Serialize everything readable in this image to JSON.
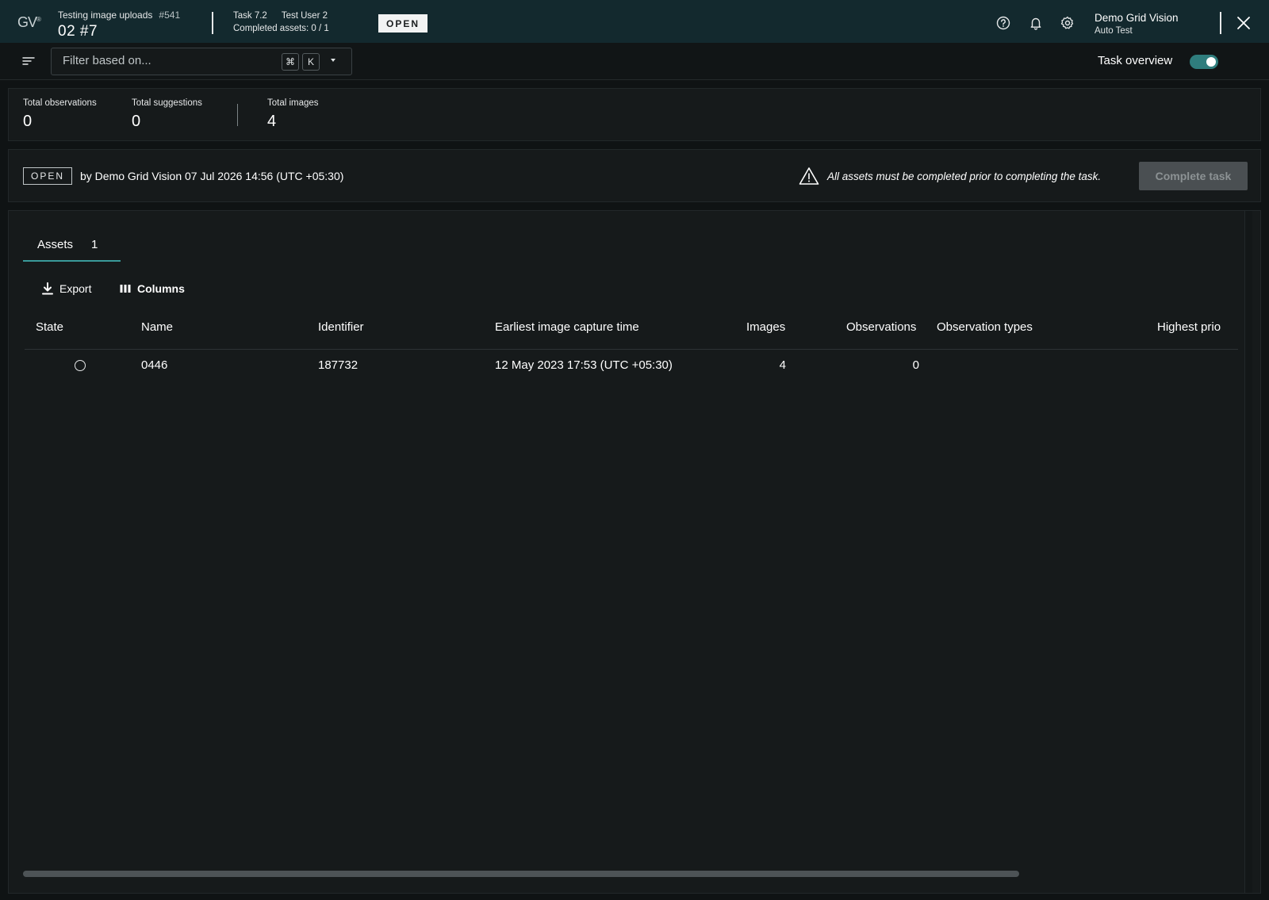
{
  "header": {
    "logo": "GV",
    "project_name": "Testing image uploads",
    "project_number": "#541",
    "subtitle": "02 #7",
    "task": "Task 7.2",
    "task_user": "Test User 2",
    "completed_assets": "Completed assets: 0 / 1",
    "status_badge": "OPEN",
    "user_name": "Demo Grid Vision",
    "user_role": "Auto Test",
    "icons": [
      "help-icon",
      "bell-icon",
      "gear-icon",
      "close-icon"
    ]
  },
  "filter": {
    "placeholder": "Filter based on...",
    "shortcut_key1": "⌘",
    "shortcut_key2": "K",
    "task_overview_label": "Task overview",
    "task_overview_on": true
  },
  "stats": {
    "total_observations_label": "Total observations",
    "total_observations": "0",
    "total_suggestions_label": "Total suggestions",
    "total_suggestions": "0",
    "total_images_label": "Total images",
    "total_images": "4"
  },
  "status": {
    "badge": "OPEN",
    "by_text": "by Demo Grid Vision 07 Jul 2026 14:56 (UTC +05:30)",
    "warning": "All assets must be completed prior to completing the task.",
    "complete_button": "Complete task"
  },
  "assets": {
    "tab_label": "Assets",
    "tab_count": "1",
    "export_label": "Export",
    "columns_label": "Columns",
    "columns": [
      "State",
      "Name",
      "Identifier",
      "Earliest image capture time",
      "Images",
      "Observations",
      "Observation types",
      "Highest prio"
    ],
    "rows": [
      {
        "name": "0446",
        "identifier": "187732",
        "capture_time": "12 May 2023 17:53 (UTC +05:30)",
        "images": "4",
        "observations": "0",
        "observation_types": "",
        "highest_priority": ""
      }
    ]
  },
  "colors": {
    "header_bg": "#13292e",
    "accent": "#3a9a9a",
    "toggle_on": "#2f7d7d",
    "panel_bg": "#161a1b"
  }
}
